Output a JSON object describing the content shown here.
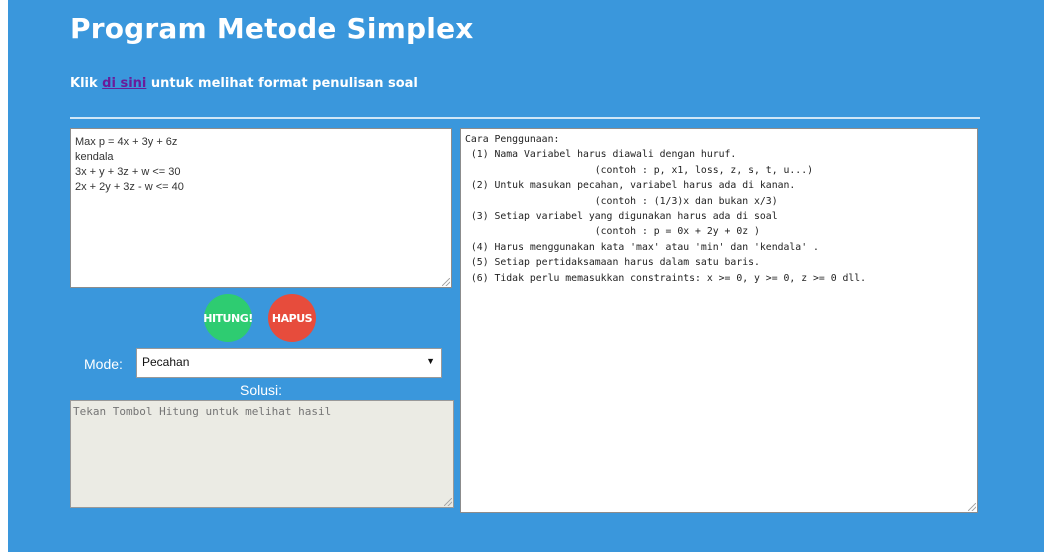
{
  "header": {
    "title": "Program Metode Simplex",
    "subtitle_prefix": "Klik ",
    "subtitle_link": "di sini",
    "subtitle_suffix": " untuk melihat format penulisan soal"
  },
  "soal": {
    "value": "Max p = 4x + 3y + 6z\nkendala\n3x + y + 3z + w <= 30\n2x + 2y + 3z - w <= 40"
  },
  "buttons": {
    "hitung": "HITUNG!",
    "hapus": "HAPUS"
  },
  "mode": {
    "label": "Mode:",
    "selected": "Pecahan"
  },
  "solusi": {
    "label": "Solusi:",
    "placeholder": "Tekan Tombol Hitung untuk melihat hasil"
  },
  "cara": {
    "text": "Cara Penggunaan:\n (1) Nama Variabel harus diawali dengan huruf.\n                      (contoh : p, x1, loss, z, s, t, u...)\n (2) Untuk masukan pecahan, variabel harus ada di kanan.\n                      (contoh : (1/3)x dan bukan x/3)\n (3) Setiap variabel yang digunakan harus ada di soal\n                      (contoh : p = 0x + 2y + 0z )\n (4) Harus menggunakan kata 'max' atau 'min' dan 'kendala' .\n (5) Setiap pertidaksamaan harus dalam satu baris.\n (6) Tidak perlu memasukkan constraints: x >= 0, y >= 0, z >= 0 dll."
  },
  "colors": {
    "background": "#3a97dc",
    "hitung": "#2ecc71",
    "hapus": "#e74c3c"
  }
}
